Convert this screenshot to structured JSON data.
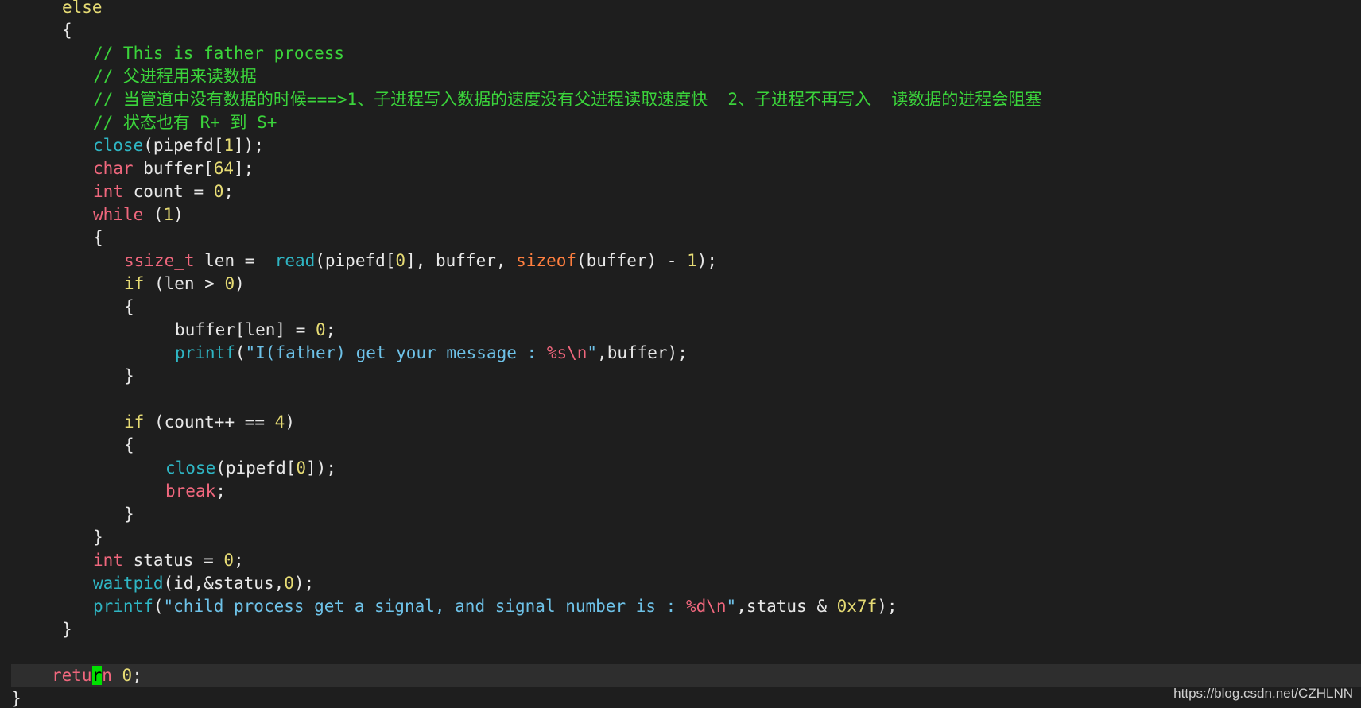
{
  "theme": {
    "background": "#1e1e1e",
    "cursorline": "#2e2e2e",
    "cursor": "#00e000",
    "token_colors": {
      "plain": "#e8e8e8",
      "keyword": "#e6db74",
      "comment": "#3bd43b",
      "func": "#2fb6c4",
      "type": "#f0677d",
      "flow": "#f0677d",
      "sizeof": "#ff7f3f",
      "number": "#e6db74",
      "string": "#6ec2e8",
      "format": "#f0677d"
    }
  },
  "editor": {
    "lines": [
      {
        "indent": 78,
        "tokens": [
          {
            "t": "else",
            "c": "keyword"
          }
        ]
      },
      {
        "indent": 78,
        "tokens": [
          {
            "t": "{",
            "c": "plain"
          }
        ]
      },
      {
        "indent": 117,
        "tokens": [
          {
            "t": "// This is father process",
            "c": "comment"
          }
        ]
      },
      {
        "indent": 117,
        "tokens": [
          {
            "t": "// 父进程用来读数据",
            "c": "comment"
          }
        ]
      },
      {
        "indent": 117,
        "tokens": [
          {
            "t": "// 当管道中没有数据的时候===>1、子进程写入数据的速度没有父进程读取速度快  2、子进程不再写入  读数据的进程会阻塞",
            "c": "comment"
          }
        ]
      },
      {
        "indent": 117,
        "tokens": [
          {
            "t": "// 状态也有 R+ 到 S+",
            "c": "comment"
          }
        ]
      },
      {
        "indent": 117,
        "tokens": [
          {
            "t": "close",
            "c": "func"
          },
          {
            "t": "(pipefd[",
            "c": "plain"
          },
          {
            "t": "1",
            "c": "number"
          },
          {
            "t": "]);",
            "c": "plain"
          }
        ]
      },
      {
        "indent": 117,
        "tokens": [
          {
            "t": "char",
            "c": "type"
          },
          {
            "t": " buffer[",
            "c": "plain"
          },
          {
            "t": "64",
            "c": "number"
          },
          {
            "t": "];",
            "c": "plain"
          }
        ]
      },
      {
        "indent": 117,
        "tokens": [
          {
            "t": "int",
            "c": "type"
          },
          {
            "t": " count = ",
            "c": "plain"
          },
          {
            "t": "0",
            "c": "number"
          },
          {
            "t": ";",
            "c": "plain"
          }
        ]
      },
      {
        "indent": 117,
        "tokens": [
          {
            "t": "while",
            "c": "flow"
          },
          {
            "t": " (",
            "c": "plain"
          },
          {
            "t": "1",
            "c": "number"
          },
          {
            "t": ")",
            "c": "plain"
          }
        ]
      },
      {
        "indent": 117,
        "tokens": [
          {
            "t": "{",
            "c": "plain"
          }
        ]
      },
      {
        "indent": 156,
        "tokens": [
          {
            "t": "ssize_t",
            "c": "type"
          },
          {
            "t": " len =  ",
            "c": "plain"
          },
          {
            "t": "read",
            "c": "func"
          },
          {
            "t": "(pipefd[",
            "c": "plain"
          },
          {
            "t": "0",
            "c": "number"
          },
          {
            "t": "], buffer, ",
            "c": "plain"
          },
          {
            "t": "sizeof",
            "c": "sizeof"
          },
          {
            "t": "(buffer) - ",
            "c": "plain"
          },
          {
            "t": "1",
            "c": "number"
          },
          {
            "t": ");",
            "c": "plain"
          }
        ]
      },
      {
        "indent": 156,
        "tokens": [
          {
            "t": "if",
            "c": "keyword"
          },
          {
            "t": " (len > ",
            "c": "plain"
          },
          {
            "t": "0",
            "c": "number"
          },
          {
            "t": ")",
            "c": "plain"
          }
        ]
      },
      {
        "indent": 156,
        "tokens": [
          {
            "t": "{",
            "c": "plain"
          }
        ]
      },
      {
        "indent": 220,
        "tokens": [
          {
            "t": "buffer[len] = ",
            "c": "plain"
          },
          {
            "t": "0",
            "c": "number"
          },
          {
            "t": ";",
            "c": "plain"
          }
        ]
      },
      {
        "indent": 220,
        "tokens": [
          {
            "t": "printf",
            "c": "func"
          },
          {
            "t": "(",
            "c": "plain"
          },
          {
            "t": "\"I(father) get your message : ",
            "c": "string"
          },
          {
            "t": "%s\\n",
            "c": "format"
          },
          {
            "t": "\"",
            "c": "string"
          },
          {
            "t": ",buffer);",
            "c": "plain"
          }
        ]
      },
      {
        "indent": 156,
        "tokens": [
          {
            "t": "}",
            "c": "plain"
          }
        ]
      },
      {
        "indent": 0,
        "tokens": []
      },
      {
        "indent": 156,
        "tokens": [
          {
            "t": "if",
            "c": "keyword"
          },
          {
            "t": " (count++ == ",
            "c": "plain"
          },
          {
            "t": "4",
            "c": "number"
          },
          {
            "t": ")",
            "c": "plain"
          }
        ]
      },
      {
        "indent": 156,
        "tokens": [
          {
            "t": "{",
            "c": "plain"
          }
        ]
      },
      {
        "indent": 208,
        "tokens": [
          {
            "t": "close",
            "c": "func"
          },
          {
            "t": "(pipefd[",
            "c": "plain"
          },
          {
            "t": "0",
            "c": "number"
          },
          {
            "t": "]);",
            "c": "plain"
          }
        ]
      },
      {
        "indent": 208,
        "tokens": [
          {
            "t": "break",
            "c": "flow"
          },
          {
            "t": ";",
            "c": "plain"
          }
        ]
      },
      {
        "indent": 156,
        "tokens": [
          {
            "t": "}",
            "c": "plain"
          }
        ]
      },
      {
        "indent": 117,
        "tokens": [
          {
            "t": "}",
            "c": "plain"
          }
        ]
      },
      {
        "indent": 117,
        "tokens": [
          {
            "t": "int",
            "c": "type"
          },
          {
            "t": " status = ",
            "c": "plain"
          },
          {
            "t": "0",
            "c": "number"
          },
          {
            "t": ";",
            "c": "plain"
          }
        ]
      },
      {
        "indent": 117,
        "tokens": [
          {
            "t": "waitpid",
            "c": "func"
          },
          {
            "t": "(id,&status,",
            "c": "plain"
          },
          {
            "t": "0",
            "c": "number"
          },
          {
            "t": ");",
            "c": "plain"
          }
        ]
      },
      {
        "indent": 117,
        "tokens": [
          {
            "t": "printf",
            "c": "func"
          },
          {
            "t": "(",
            "c": "plain"
          },
          {
            "t": "\"child process get a signal, and signal number is : ",
            "c": "string"
          },
          {
            "t": "%d\\n",
            "c": "format"
          },
          {
            "t": "\"",
            "c": "string"
          },
          {
            "t": ",status & ",
            "c": "plain"
          },
          {
            "t": "0x7f",
            "c": "number"
          },
          {
            "t": ");",
            "c": "plain"
          }
        ]
      },
      {
        "indent": 78,
        "tokens": [
          {
            "t": "}",
            "c": "plain"
          }
        ]
      },
      {
        "indent": 0,
        "tokens": []
      },
      {
        "indent": 65,
        "cursorline": true,
        "tokens": [
          {
            "t": "retu",
            "c": "flow"
          },
          {
            "t": "r",
            "c": "flow",
            "cursor": true
          },
          {
            "t": "n",
            "c": "flow"
          },
          {
            "t": " ",
            "c": "plain"
          },
          {
            "t": "0",
            "c": "number"
          },
          {
            "t": ";",
            "c": "plain"
          }
        ]
      },
      {
        "indent": 14,
        "tokens": [
          {
            "t": "}",
            "c": "plain"
          }
        ]
      }
    ]
  },
  "watermark": {
    "text": "https://blog.csdn.net/CZHLNN"
  }
}
